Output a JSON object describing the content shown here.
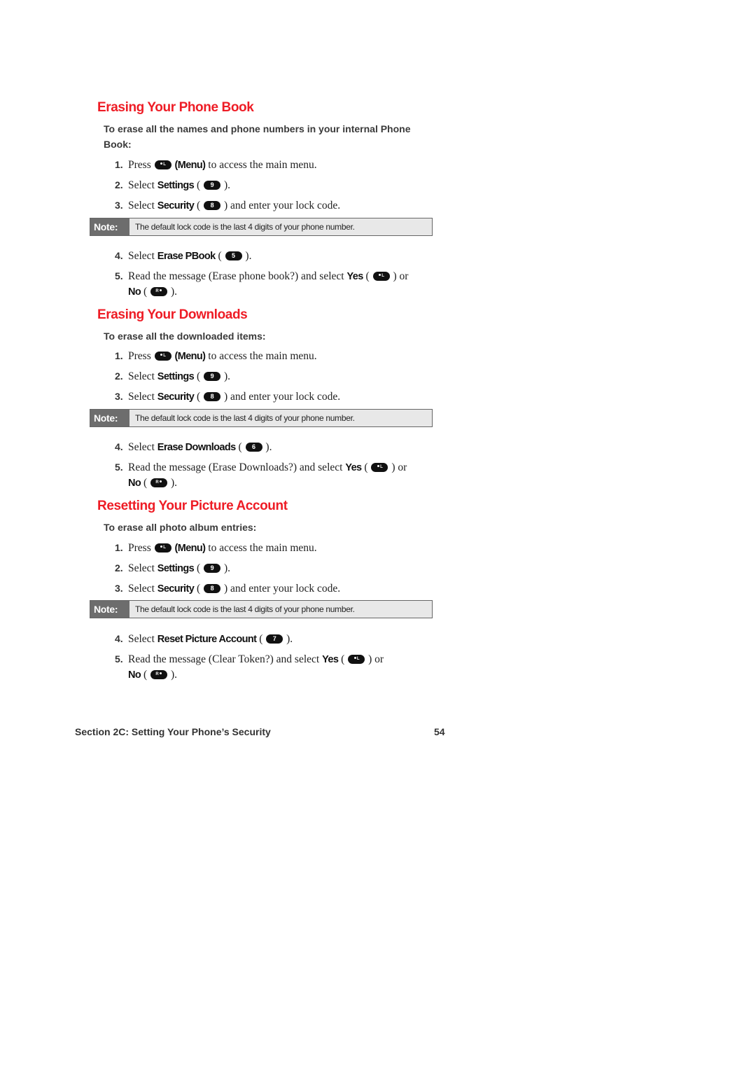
{
  "sections": [
    {
      "title": "Erasing Your Phone Book",
      "intro": "To erase all the names and phone numbers in your internal Phone Book:",
      "steps_before_note": [
        {
          "num": "1.",
          "pre": "Press ",
          "key": "L-Left",
          "post_bold": "(Menu)",
          "post": " to access the main menu."
        },
        {
          "num": "2.",
          "pre": "Select ",
          "bold": "Settings",
          "key": "9 WXYZ",
          "post": " )."
        },
        {
          "num": "3.",
          "pre": "Select ",
          "bold": "Security",
          "key": "8 TUV",
          "post": " ) and enter your lock code."
        }
      ],
      "note": {
        "label": "Note:",
        "text": "The default lock code is the last 4 digits of your phone number."
      },
      "step4": {
        "num": "4.",
        "pre": "Select ",
        "bold": "Erase PBook",
        "key": "5 JKL",
        "post": " )."
      },
      "step5": {
        "num": "5.",
        "pre": "Read the message (Erase phone book?) and select ",
        "yes": "Yes",
        "yes_key": "L-Left",
        "or": " ) or",
        "no": "No",
        "no_key": "Right",
        "end": " )."
      }
    },
    {
      "title": "Erasing Your Downloads",
      "intro": "To erase all the downloaded items:",
      "steps_before_note": [
        {
          "num": "1.",
          "pre": "Press ",
          "key": "L-Left",
          "post_bold": "(Menu)",
          "post": " to access the main menu."
        },
        {
          "num": "2.",
          "pre": "Select ",
          "bold": "Settings",
          "key": "9 WXYZ",
          "post": " )."
        },
        {
          "num": "3.",
          "pre": "Select ",
          "bold": "Security",
          "key": "8 TUV",
          "post": " ) and enter your lock code."
        }
      ],
      "note": {
        "label": "Note:",
        "text": "The default lock code is the last 4 digits of your phone number."
      },
      "step4": {
        "num": "4.",
        "pre": "Select ",
        "bold": "Erase Downloads",
        "key": "6 MNO",
        "post": " )."
      },
      "step5": {
        "num": "5.",
        "pre": "Read the message (Erase Downloads?) and select ",
        "yes": "Yes",
        "yes_key": "L-Left",
        "or": " ) or",
        "no": "No",
        "no_key": "Right",
        "end": " )."
      }
    },
    {
      "title": "Resetting Your Picture Account",
      "intro": "To erase all photo album entries:",
      "steps_before_note": [
        {
          "num": "1.",
          "pre": "Press ",
          "key": "L-Left",
          "post_bold": "(Menu)",
          "post": " to access the main menu."
        },
        {
          "num": "2.",
          "pre": "Select ",
          "bold": "Settings",
          "key": "9 WXYZ",
          "post": " )."
        },
        {
          "num": "3.",
          "pre": "Select ",
          "bold": "Security",
          "key": "8 TUV",
          "post": " ) and enter your lock code."
        }
      ],
      "note": {
        "label": "Note:",
        "text": "The default lock code is the last 4 digits of your phone number."
      },
      "step4": {
        "num": "4.",
        "pre": "Select ",
        "bold": "Reset Picture Account",
        "key": "7 PQRS",
        "post": " )."
      },
      "step5": {
        "num": "5.",
        "pre": "Read the message (Clear Token?) and select ",
        "yes": "Yes",
        "yes_key": "L-Left",
        "or": " ) or",
        "no": "No",
        "no_key": "Right",
        "end": " )."
      }
    }
  ],
  "common": {
    "open_paren": " ( "
  },
  "footer": {
    "section": "Section 2C: Setting Your Phone’s Security",
    "page": "54"
  },
  "colors": {
    "heading": "#ee1c25",
    "note_label_bg": "#6d6d6d",
    "note_bg": "#e8e8e8"
  }
}
